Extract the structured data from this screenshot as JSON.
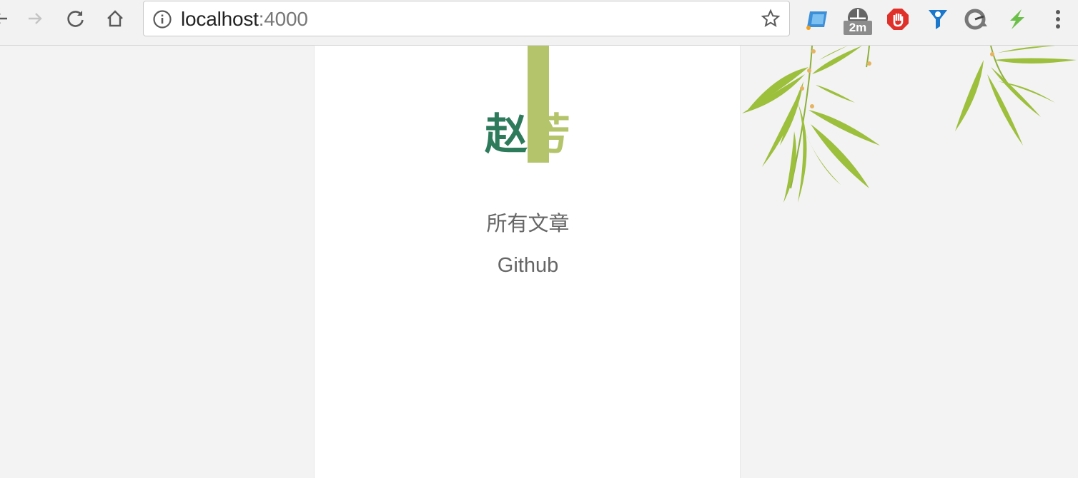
{
  "browser": {
    "url_host": "localhost",
    "url_port": ":4000",
    "extension_badge": "2m"
  },
  "site": {
    "logo_char1": "赵",
    "logo_char2": "芳",
    "nav": [
      {
        "label": "所有文章"
      },
      {
        "label": "Github"
      }
    ]
  },
  "colors": {
    "accent_green": "#2e7b5c",
    "accent_lime": "#b4c46a",
    "menu_text": "#666666"
  }
}
